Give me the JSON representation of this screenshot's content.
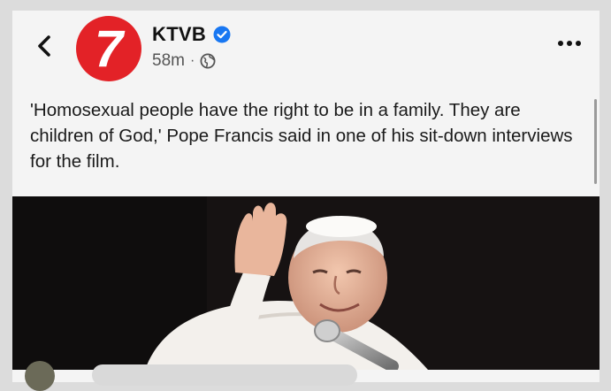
{
  "header": {
    "back_icon": "chevron-left-icon",
    "page_avatar_text": "7",
    "page_name": "KTVB",
    "verified_icon": "verified-badge-icon",
    "timestamp": "58m",
    "separator": "·",
    "audience_icon": "globe-icon",
    "more_icon": "more-horizontal-icon"
  },
  "post": {
    "text": "'Homosexual people have the right to be in a family. They are children of God,' Pope Francis said in one of his sit-down interviews for the film."
  },
  "colors": {
    "brand_red": "#e32227",
    "verified_blue": "#1877f2",
    "media_background": "#161212"
  }
}
